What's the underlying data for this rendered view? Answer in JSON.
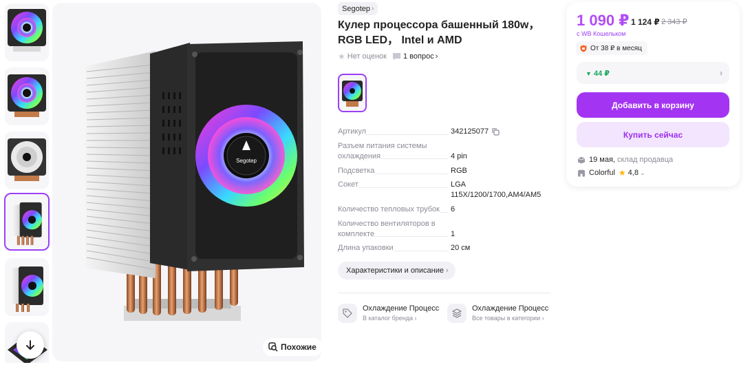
{
  "gallery": {
    "thumbnails": [
      {
        "label": "Фото 1"
      },
      {
        "label": "Фото 2"
      },
      {
        "label": "Фото 3"
      },
      {
        "label": "Фото 4",
        "active": true
      },
      {
        "label": "Фото 5"
      },
      {
        "label": "Фото 6"
      }
    ],
    "similar_label": "Похожие"
  },
  "product": {
    "brand": "Segotep",
    "title": "Кулер процессора башенный 180w，RGB LED， Intel и AMD",
    "rating_text": "Нет оценок",
    "questions_text": "1 вопрос",
    "logo_text": "Segotep"
  },
  "specs": [
    {
      "key": "Артикул",
      "value": "342125077"
    },
    {
      "key": "Разъем питания системы охлаждения",
      "value": "4 pin"
    },
    {
      "key": "Подсветка",
      "value": "RGB"
    },
    {
      "key": "Сокет",
      "value": "LGA 115X/1200/1700,AM4/AM5"
    },
    {
      "key": "Количество тепловых трубок",
      "value": "6"
    },
    {
      "key": "Количество вентиляторов в комплекте",
      "value": "1"
    },
    {
      "key": "Длина упаковки",
      "value": "20 см"
    }
  ],
  "characteristics_button": "Характеристики и описание",
  "links": [
    {
      "title": "Охлаждение Процессора",
      "subtitle": "В каталог бренда"
    },
    {
      "title": "Охлаждение Процессора",
      "subtitle": "Все товары в категории"
    }
  ],
  "price_card": {
    "price": "1 090 ₽",
    "price_without_wallet": "1 124 ₽",
    "old_price": "2 343 ₽",
    "wallet_note": "с WB Кошельком",
    "installment": "От 38 ₽ в месяц",
    "cashback": "44 ₽",
    "add_to_cart": "Добавить в корзину",
    "buy_now": "Купить сейчас",
    "delivery_date": "19 мая,",
    "delivery_source": "склад продавца",
    "seller": "Colorful",
    "seller_rating": "4,8"
  },
  "colors": {
    "accent": "#a335f2",
    "price": "#b14cf6",
    "cashback_green": "#1aa85a"
  }
}
